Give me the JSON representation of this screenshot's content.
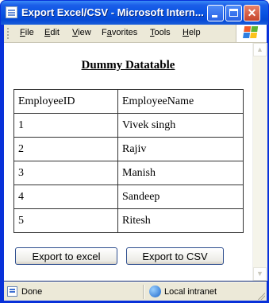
{
  "window": {
    "title": "Export Excel/CSV - Microsoft Intern...",
    "close_glyph": "✕"
  },
  "menu": {
    "items": [
      "File",
      "Edit",
      "View",
      "Favorites",
      "Tools",
      "Help"
    ],
    "mnemonics": [
      "F",
      "E",
      "V",
      "a",
      "T",
      "H"
    ]
  },
  "page": {
    "heading": "Dummy Datatable",
    "table": {
      "columns": [
        "EmployeeID",
        "EmployeeName"
      ],
      "rows": [
        [
          "1",
          "Vivek singh"
        ],
        [
          "2",
          "Rajiv"
        ],
        [
          "3",
          "Manish"
        ],
        [
          "4",
          "Sandeep"
        ],
        [
          "5",
          "Ritesh"
        ]
      ]
    },
    "buttons": {
      "export_excel": "Export to excel",
      "export_csv": "Export to CSV"
    }
  },
  "statusbar": {
    "status": "Done",
    "zone": "Local intranet"
  },
  "colors": {
    "titlebar": "#0a55e3",
    "chrome": "#ece9d8"
  }
}
